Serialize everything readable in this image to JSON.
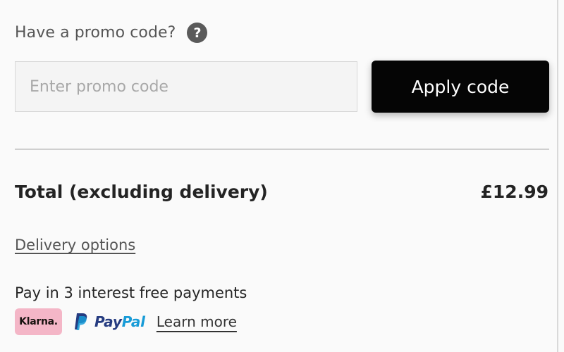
{
  "promo": {
    "question": "Have a promo code?",
    "help_icon": "question-mark-icon",
    "input_placeholder": "Enter promo code",
    "input_value": "",
    "apply_label": "Apply code"
  },
  "summary": {
    "total_label": "Total (excluding delivery)",
    "total_value": "£12.99"
  },
  "delivery": {
    "link_label": "Delivery options"
  },
  "payment": {
    "installments_text": "Pay in 3 interest free payments",
    "klarna_label": "Klarna.",
    "paypal_label_pay": "Pay",
    "paypal_label_pal": "Pal",
    "learn_more_label": "Learn more"
  },
  "colors": {
    "background": "#fafafa",
    "button_bg": "#050505",
    "klarna_pink": "#f4b6c7",
    "paypal_dark_blue": "#253b80",
    "paypal_light_blue": "#179bd7"
  }
}
